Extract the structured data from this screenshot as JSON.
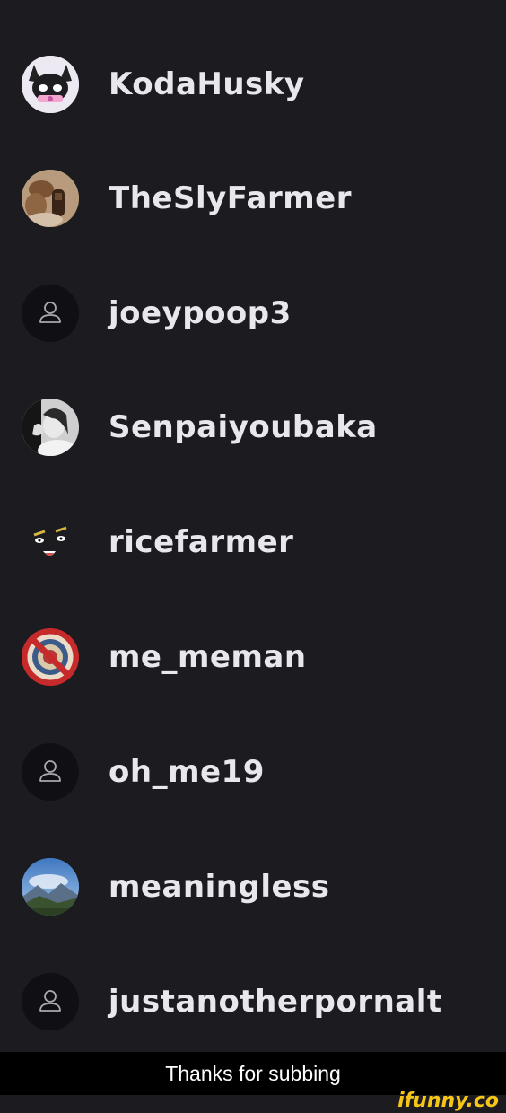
{
  "subscribers": [
    {
      "name": "KodaHusky",
      "avatar": "husky-cartoon-avatar"
    },
    {
      "name": "TheSlyFarmer",
      "avatar": "dog-photo-avatar"
    },
    {
      "name": "joeypoop3",
      "avatar": "default-user-icon"
    },
    {
      "name": "Senpaiyoubaka",
      "avatar": "bw-portrait-avatar"
    },
    {
      "name": "ricefarmer",
      "avatar": "anime-face-avatar"
    },
    {
      "name": "me_meman",
      "avatar": "no-symbol-seal-avatar"
    },
    {
      "name": "oh_me19",
      "avatar": "default-user-icon"
    },
    {
      "name": "meaningless",
      "avatar": "mountain-landscape-avatar"
    },
    {
      "name": "justanotherpornalt",
      "avatar": "default-user-icon"
    }
  ],
  "caption": "Thanks for subbing",
  "watermark": "ifunny.co",
  "colors": {
    "background": "#1b1b20",
    "text": "#e8e8ec",
    "default_avatar_bg": "#101014",
    "watermark": "#f5c518"
  }
}
